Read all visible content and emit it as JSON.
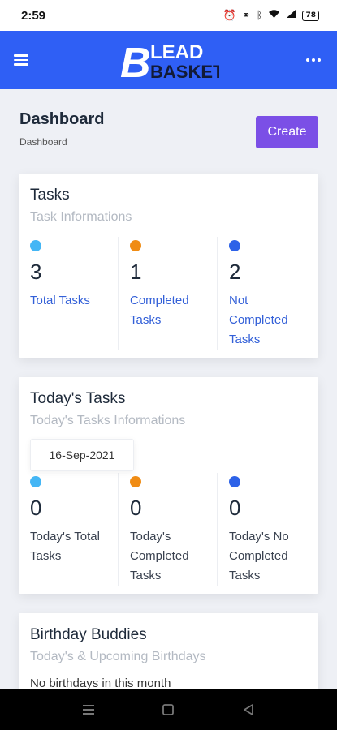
{
  "status_bar": {
    "time": "2:59",
    "icons": [
      "alarm-icon",
      "link-icon",
      "bluetooth-icon",
      "wifi-icon",
      "signal-icon"
    ],
    "battery": "78"
  },
  "header": {
    "logo_text": "LEAD",
    "logo_text2": "BASKET",
    "brand_color": "#2f5ff5"
  },
  "page": {
    "title": "Dashboard",
    "breadcrumb": "Dashboard",
    "create_label": "Create",
    "create_color": "#7b4fe6"
  },
  "tasks": {
    "title": "Tasks",
    "subtitle": "Task Informations",
    "stats": [
      {
        "value": "3",
        "label": "Total Tasks",
        "color": "#44b6f5"
      },
      {
        "value": "1",
        "label": "Completed Tasks",
        "color": "#f08c14"
      },
      {
        "value": "2",
        "label": "Not Completed Tasks",
        "color": "#2d62e8"
      }
    ]
  },
  "today": {
    "title": "Today's Tasks",
    "subtitle": "Today's Tasks Informations",
    "date": "16-Sep-2021",
    "stats": [
      {
        "value": "0",
        "label": "Today's Total Tasks",
        "color": "#44b6f5"
      },
      {
        "value": "0",
        "label": "Today's Completed Tasks",
        "color": "#f08c14"
      },
      {
        "value": "0",
        "label": "Today's No Completed Tasks",
        "color": "#2d62e8"
      }
    ]
  },
  "birthdays": {
    "title": "Birthday Buddies",
    "subtitle": "Today's & Upcoming Birthdays",
    "empty_text": "No birthdays in this month"
  },
  "nav": {
    "icons": [
      "recents-icon",
      "home-icon",
      "back-icon"
    ]
  }
}
